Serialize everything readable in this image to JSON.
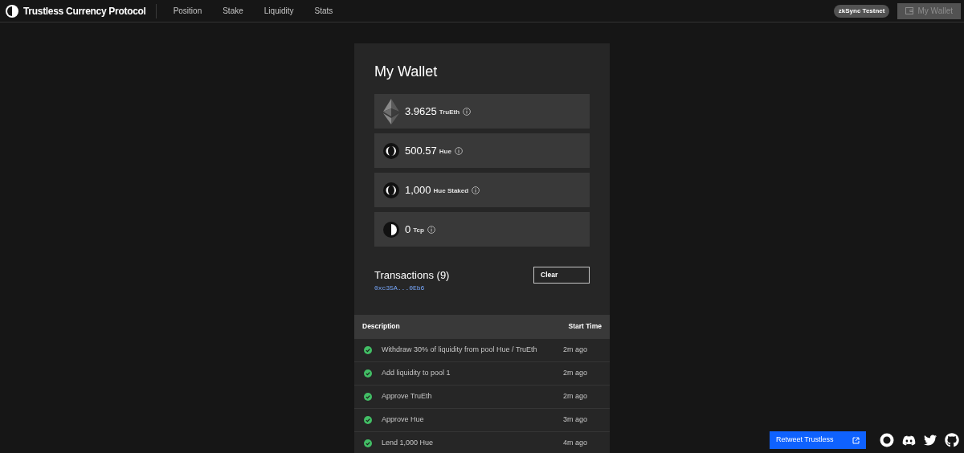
{
  "nav": {
    "brand": "Trustless Currency Protocol",
    "links": [
      {
        "label": "Position"
      },
      {
        "label": "Stake"
      },
      {
        "label": "Liquidity"
      },
      {
        "label": "Stats"
      }
    ],
    "network": "zkSync Testnet",
    "wallet_button": "My Wallet"
  },
  "wallet": {
    "title": "My Wallet",
    "balances": [
      {
        "kind": "eth",
        "amount": "3.9625",
        "unit": "TruEth"
      },
      {
        "kind": "hue",
        "amount": "500.57",
        "unit": "Hue"
      },
      {
        "kind": "hue",
        "amount": "1,000",
        "unit": "Hue Staked"
      },
      {
        "kind": "tcp",
        "amount": "0",
        "unit": "Tcp"
      }
    ],
    "transactions": {
      "title": "Transactions (9)",
      "address": "0xc35A...0Eb6",
      "clear_button": "Clear",
      "columns": [
        "Description",
        "Start Time"
      ],
      "rows": [
        {
          "succeeded": true,
          "description": "Withdraw 30% of liquidity from pool Hue / TruEth",
          "time": "2m ago"
        },
        {
          "succeeded": true,
          "description": "Add liquidity to pool 1",
          "time": "2m ago"
        },
        {
          "succeeded": true,
          "description": "Approve TruEth",
          "time": "2m ago"
        },
        {
          "succeeded": true,
          "description": "Approve Hue",
          "time": "3m ago"
        },
        {
          "succeeded": true,
          "description": "Lend 1,000 Hue",
          "time": "4m ago"
        }
      ]
    }
  },
  "footer": {
    "retweet_button": "Retweet Trustless"
  }
}
